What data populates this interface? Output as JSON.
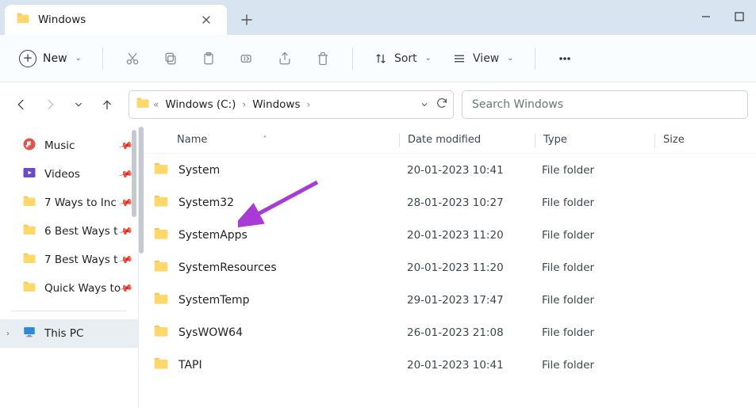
{
  "tab": {
    "title": "Windows"
  },
  "toolbar": {
    "new_label": "New",
    "sort_label": "Sort",
    "view_label": "View"
  },
  "breadcrumb": {
    "root": "Windows (C:)",
    "current": "Windows"
  },
  "search": {
    "placeholder": "Search Windows"
  },
  "columns": {
    "name": "Name",
    "date": "Date modified",
    "type": "Type",
    "size": "Size"
  },
  "sidebar": {
    "items": [
      {
        "label": "Music",
        "icon": "music",
        "pinned": true
      },
      {
        "label": "Videos",
        "icon": "videos",
        "pinned": true
      },
      {
        "label": "7 Ways to Inc",
        "icon": "folder",
        "pinned": true
      },
      {
        "label": "6 Best Ways t",
        "icon": "folder",
        "pinned": true
      },
      {
        "label": "7 Best Ways t",
        "icon": "folder",
        "pinned": true
      },
      {
        "label": "Quick Ways to",
        "icon": "folder",
        "pinned": true
      }
    ],
    "thispc": "This PC"
  },
  "rows": [
    {
      "name": "System",
      "date": "20-01-2023 10:41",
      "type": "File folder"
    },
    {
      "name": "System32",
      "date": "28-01-2023 10:27",
      "type": "File folder"
    },
    {
      "name": "SystemApps",
      "date": "20-01-2023 11:20",
      "type": "File folder"
    },
    {
      "name": "SystemResources",
      "date": "20-01-2023 11:20",
      "type": "File folder"
    },
    {
      "name": "SystemTemp",
      "date": "29-01-2023 17:47",
      "type": "File folder"
    },
    {
      "name": "SysWOW64",
      "date": "26-01-2023 21:08",
      "type": "File folder"
    },
    {
      "name": "TAPI",
      "date": "20-01-2023 10:41",
      "type": "File folder"
    }
  ]
}
